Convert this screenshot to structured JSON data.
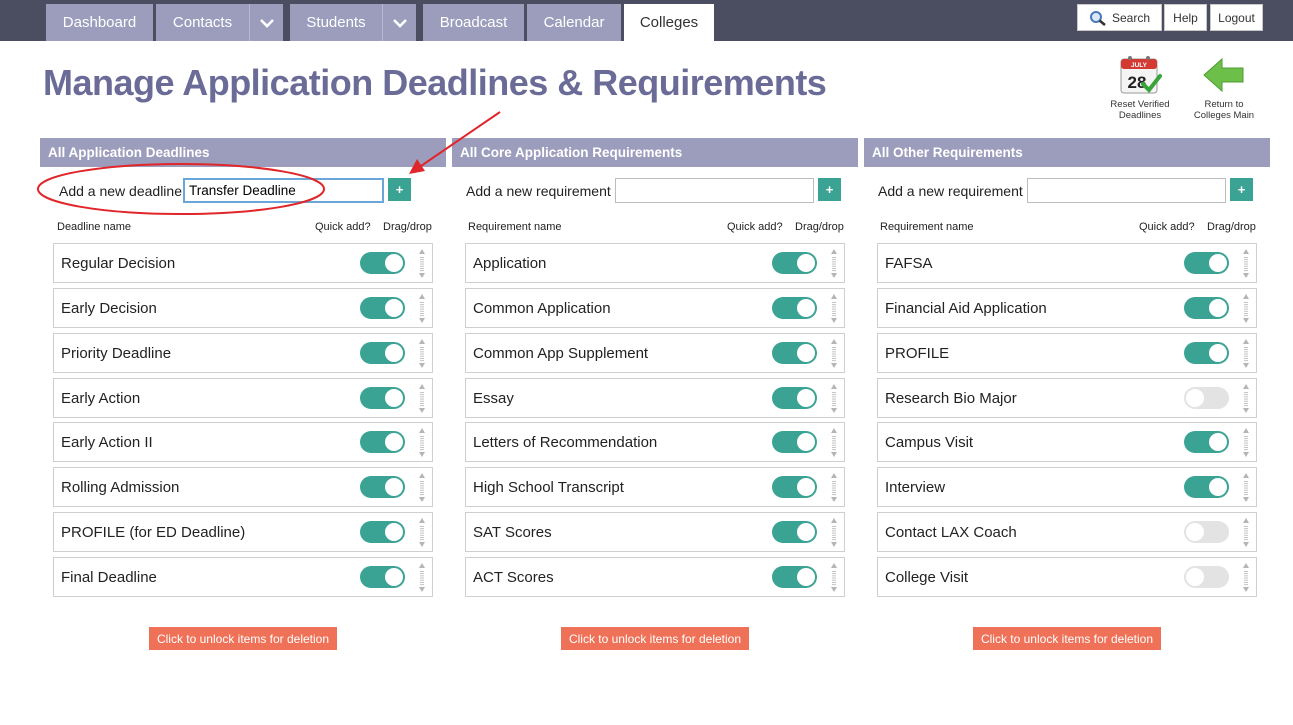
{
  "nav": {
    "tabs": [
      {
        "label": "Dashboard"
      },
      {
        "label": "Contacts"
      },
      {
        "label": "Students"
      },
      {
        "label": "Broadcast"
      },
      {
        "label": "Calendar"
      },
      {
        "label": "Colleges",
        "active": true
      }
    ],
    "utilities": {
      "search": "Search",
      "help": "Help",
      "logout": "Logout"
    }
  },
  "page": {
    "title": "Manage Application Deadlines & Requirements"
  },
  "actions": {
    "reset": {
      "label_line1": "Reset Verified",
      "label_line2": "Deadlines",
      "calendar_month": "JULY",
      "calendar_day": "28"
    },
    "return": {
      "label_line1": "Return to",
      "label_line2": "Colleges Main"
    }
  },
  "colors": {
    "accent_teal": "#3aa394",
    "header_lavender": "#9c9dbd",
    "title_purple": "#6b6b98",
    "delete_orange": "#ee7158",
    "annotation_red": "#e0262a"
  },
  "columns": [
    {
      "header": "All Application Deadlines",
      "add_label": "Add a new deadline",
      "add_value": "Transfer Deadline",
      "add_placeholder": "",
      "name_header": "Deadline name",
      "quick_header": "Quick add?",
      "drag_header": "Drag/drop",
      "items": [
        {
          "label": "Regular Decision",
          "on": true
        },
        {
          "label": "Early Decision",
          "on": true
        },
        {
          "label": "Priority Deadline",
          "on": true
        },
        {
          "label": "Early Action",
          "on": true
        },
        {
          "label": "Early Action II",
          "on": true
        },
        {
          "label": "Rolling Admission",
          "on": true
        },
        {
          "label": "PROFILE (for ED Deadline)",
          "on": true
        },
        {
          "label": "Final Deadline",
          "on": true
        }
      ],
      "delete_label": "Click to unlock items for deletion"
    },
    {
      "header": "All Core Application Requirements",
      "add_label": "Add a new requirement",
      "add_value": "",
      "add_placeholder": "",
      "name_header": "Requirement name",
      "quick_header": "Quick add?",
      "drag_header": "Drag/drop",
      "items": [
        {
          "label": "Application",
          "on": true
        },
        {
          "label": "Common Application",
          "on": true
        },
        {
          "label": "Common App Supplement",
          "on": true
        },
        {
          "label": "Essay",
          "on": true
        },
        {
          "label": "Letters of Recommendation",
          "on": true
        },
        {
          "label": "High School Transcript",
          "on": true
        },
        {
          "label": "SAT Scores",
          "on": true
        },
        {
          "label": "ACT Scores",
          "on": true
        }
      ],
      "delete_label": "Click to unlock items for deletion"
    },
    {
      "header": "All Other Requirements",
      "add_label": "Add a new requirement",
      "add_value": "",
      "add_placeholder": "",
      "name_header": "Requirement name",
      "quick_header": "Quick add?",
      "drag_header": "Drag/drop",
      "items": [
        {
          "label": "FAFSA",
          "on": true
        },
        {
          "label": "Financial Aid Application",
          "on": true
        },
        {
          "label": "PROFILE",
          "on": true
        },
        {
          "label": "Research Bio Major",
          "on": false
        },
        {
          "label": "Campus Visit",
          "on": true
        },
        {
          "label": "Interview",
          "on": true
        },
        {
          "label": "Contact LAX Coach",
          "on": false
        },
        {
          "label": "College Visit",
          "on": false
        }
      ],
      "delete_label": "Click to unlock items for deletion"
    }
  ]
}
